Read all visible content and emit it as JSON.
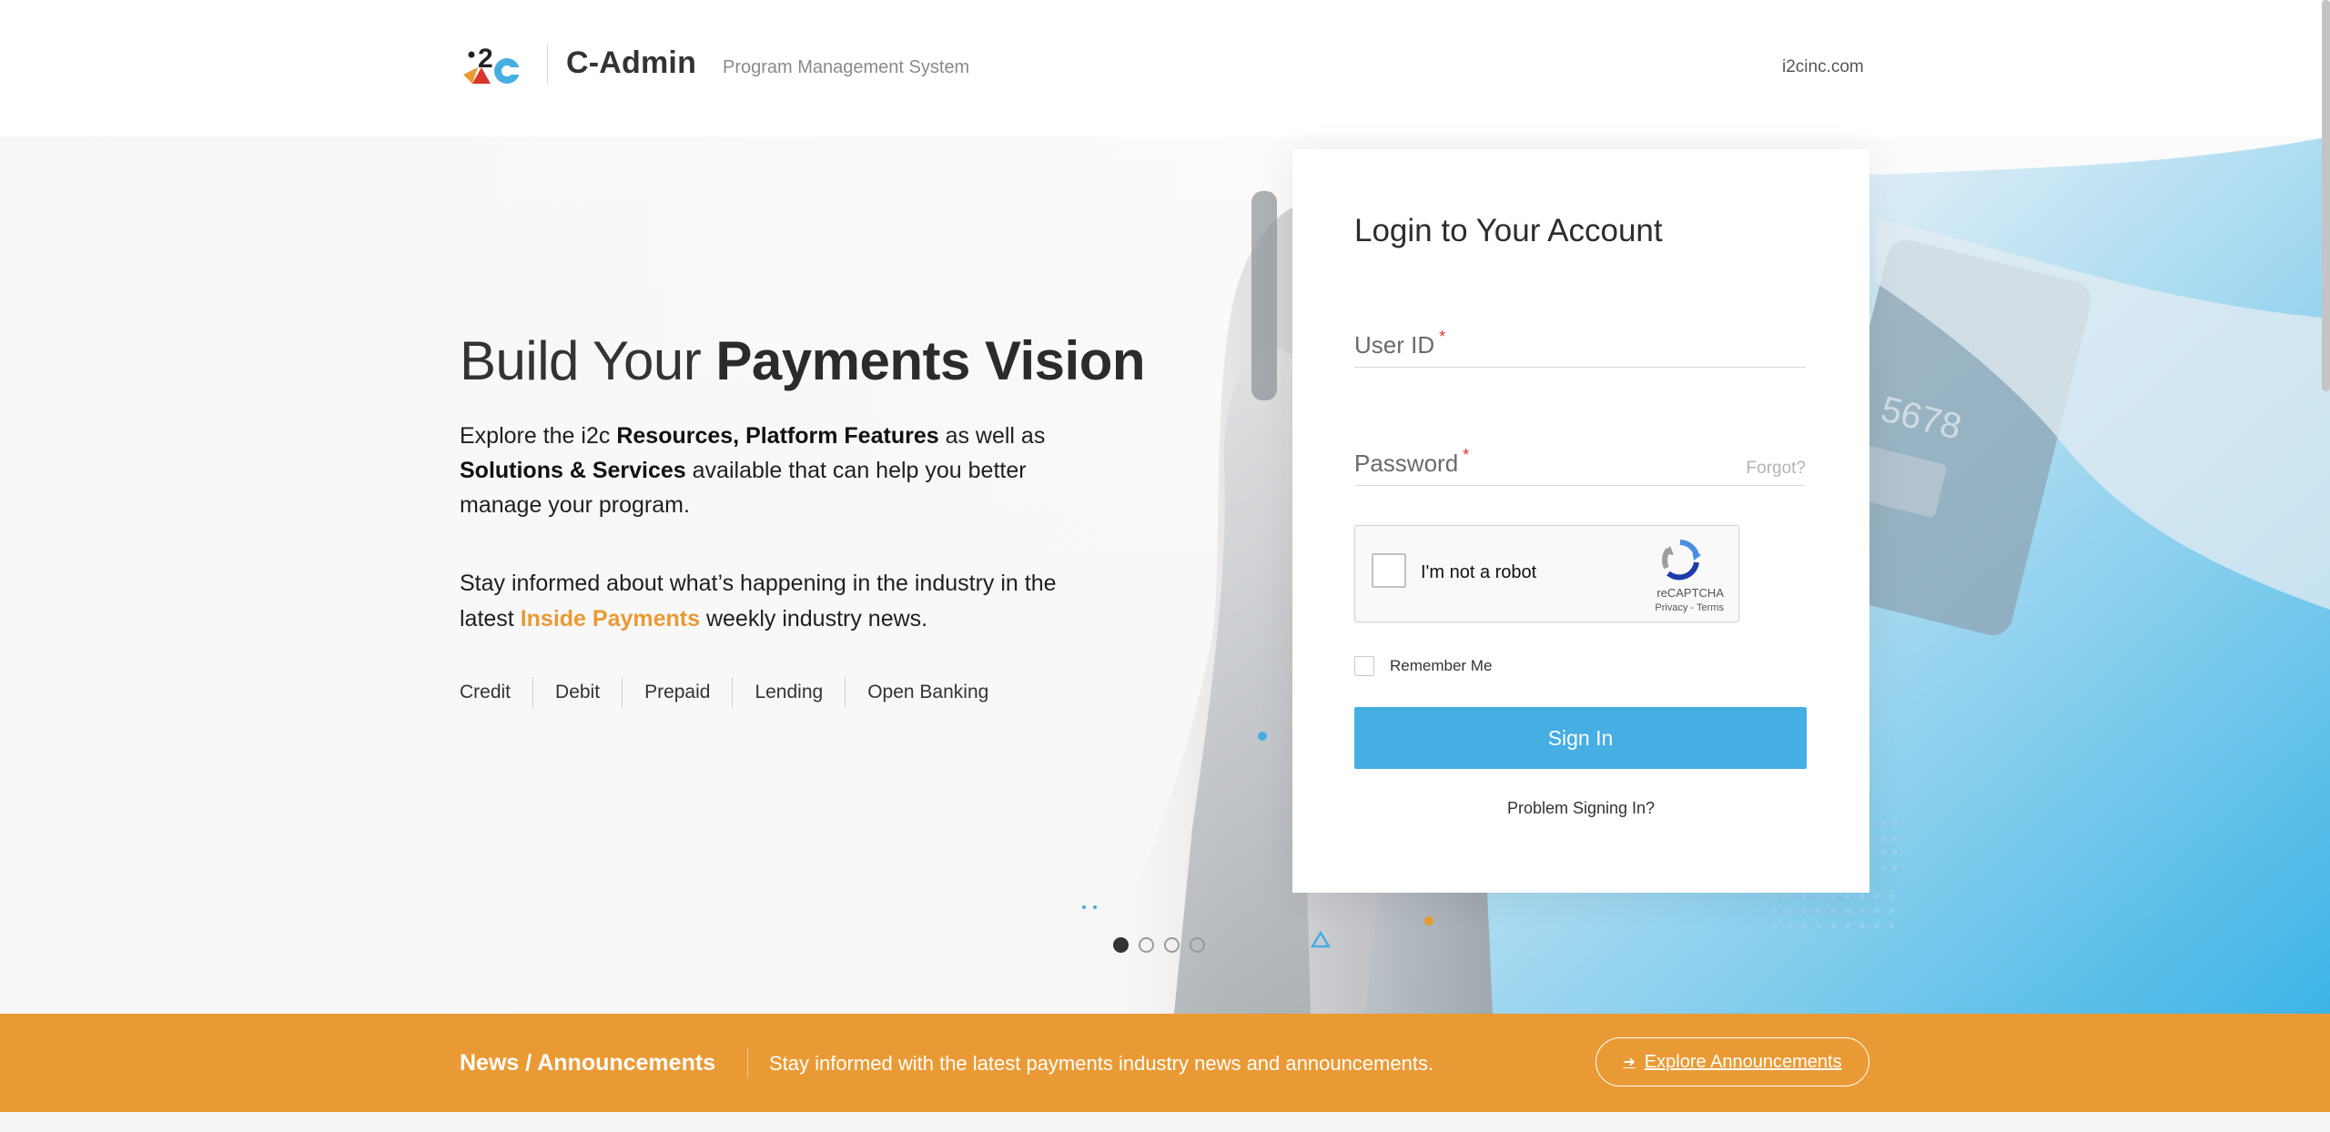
{
  "header": {
    "brand": "C-Admin",
    "subtitle": "Program Management System",
    "site_link": "i2cinc.com"
  },
  "hero": {
    "title_light": "Build Your ",
    "title_bold": "Payments Vision",
    "p1": {
      "t1": "Explore the i2c ",
      "b1": "Resources, Platform Features",
      "t2": " as well as ",
      "b2": "Solutions & Services",
      "t3": " available that can help you better manage your program."
    },
    "p2": {
      "t1": "Stay informed about what’s happening in the industry in the latest ",
      "accent": "Inside Payments",
      "t2": " weekly industry news."
    },
    "tags": [
      "Credit",
      "Debit",
      "Prepaid",
      "Lending",
      "Open Banking"
    ],
    "carousel": {
      "slides": 4,
      "active": 1
    }
  },
  "login": {
    "title": "Login to Your Account",
    "user_id_label": "User ID",
    "password_label": "Password",
    "required_mark": "*",
    "forgot": "Forgot?",
    "captcha_label": "I'm not a robot",
    "captcha_brand": "reCAPTCHA",
    "captcha_links": "Privacy - Terms",
    "remember_me": "Remember Me",
    "sign_in": "Sign In",
    "problem": "Problem Signing In?"
  },
  "news": {
    "title": "News / Announcements",
    "text": "Stay informed with the latest payments industry news and announcements.",
    "button": "Explore Announcements"
  },
  "colors": {
    "accent_orange": "#ea9a34",
    "accent_blue": "#45aee3",
    "required_red": "#e0332f"
  },
  "icons": [
    "i2c-logo-icon",
    "recaptcha-icon",
    "arrow-right-icon"
  ]
}
